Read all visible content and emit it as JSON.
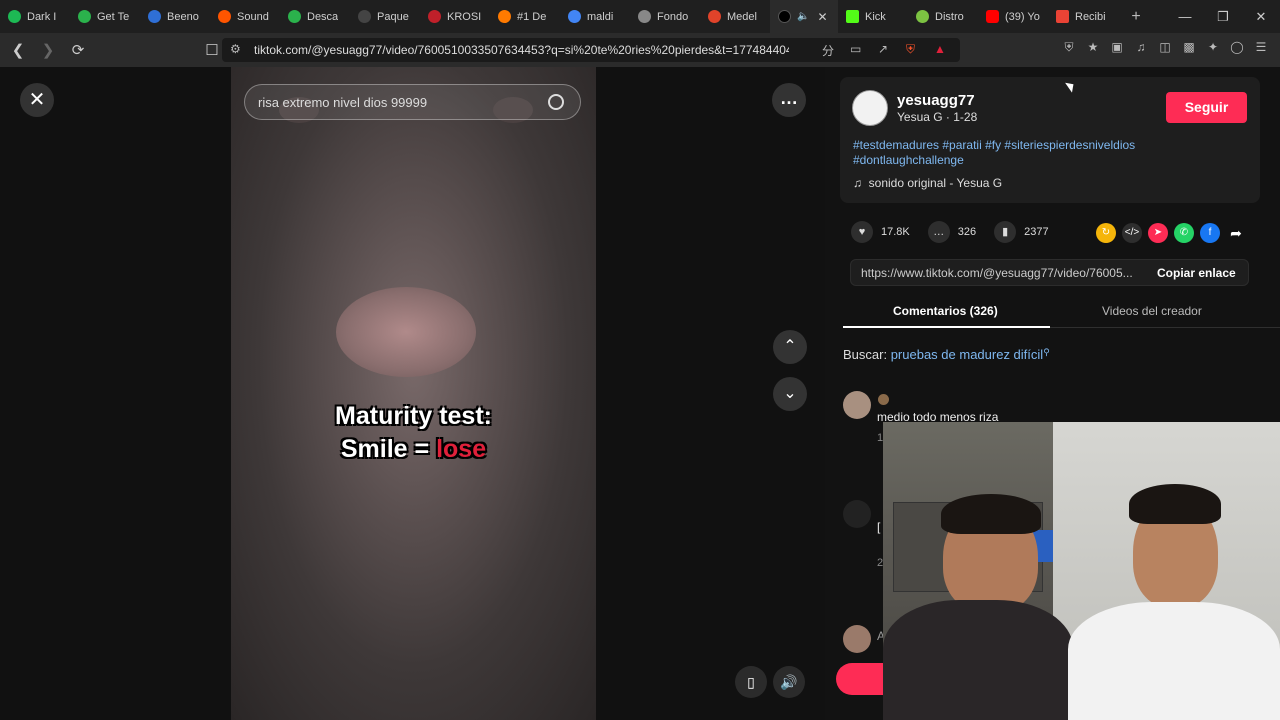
{
  "tabs": [
    {
      "label": "Dark I",
      "color": "#1db954"
    },
    {
      "label": "Get Te",
      "color": "#2bb24c"
    },
    {
      "label": "Beeno",
      "color": "#2f6fd6"
    },
    {
      "label": "Sound",
      "color": "#ff5500"
    },
    {
      "label": "Desca",
      "color": "#2bb24c"
    },
    {
      "label": "Paque",
      "color": "#222222"
    },
    {
      "label": "KROSI",
      "color": "#c0202a"
    },
    {
      "label": "#1 De",
      "color": "#ff7a00"
    },
    {
      "label": "maldi",
      "color": "#4285f4"
    },
    {
      "label": "Fondo",
      "color": "#888888"
    },
    {
      "label": "Medel",
      "color": "#e0432a"
    },
    {
      "label": "",
      "color": "#111111"
    },
    {
      "label": "Kick",
      "color": "#53fc18"
    },
    {
      "label": "Distro",
      "color": "#7cc242"
    },
    {
      "label": "(39) Yo",
      "color": "#ff0000"
    },
    {
      "label": "Recibi",
      "color": "#ea4335"
    }
  ],
  "url": "tiktok.com/@yesuagg77/video/7600510033507634453?q=si%20te%20ries%20pierdes&t=177484404...",
  "video": {
    "search_query": "risa extremo nivel dios 99999",
    "caption_line1": "Maturity test:",
    "caption_smile": "Smile = ",
    "caption_lose": "lose"
  },
  "author": {
    "username": "yesuagg77",
    "subtitle": "Yesua G · 1-28",
    "follow_label": "Seguir"
  },
  "description": {
    "hashtags": "#testdemadures #paratii #fy #siteriespierdesniveldios #dontlaughchallenge",
    "sound": "sonido original - Yesua G"
  },
  "stats": {
    "likes": "17.8K",
    "comments": "326",
    "saves": "2377"
  },
  "share": {
    "link": "https://www.tiktok.com/@yesuagg77/video/76005...",
    "copy_label": "Copiar enlace"
  },
  "panel_tabs": {
    "comments": "Comentarios (326)",
    "creator_videos": "Videos del creador"
  },
  "search_suggestion": {
    "prefix": "Buscar:",
    "term": "pruebas de madurez difícil"
  },
  "comments": [
    {
      "text": "medio todo menos riza",
      "meta": "1"
    },
    {
      "text": "[",
      "meta": "2"
    },
    {
      "text": "A",
      "meta": ""
    }
  ],
  "colors": {
    "accent": "#fe2c55",
    "link": "#7fb8f0"
  }
}
